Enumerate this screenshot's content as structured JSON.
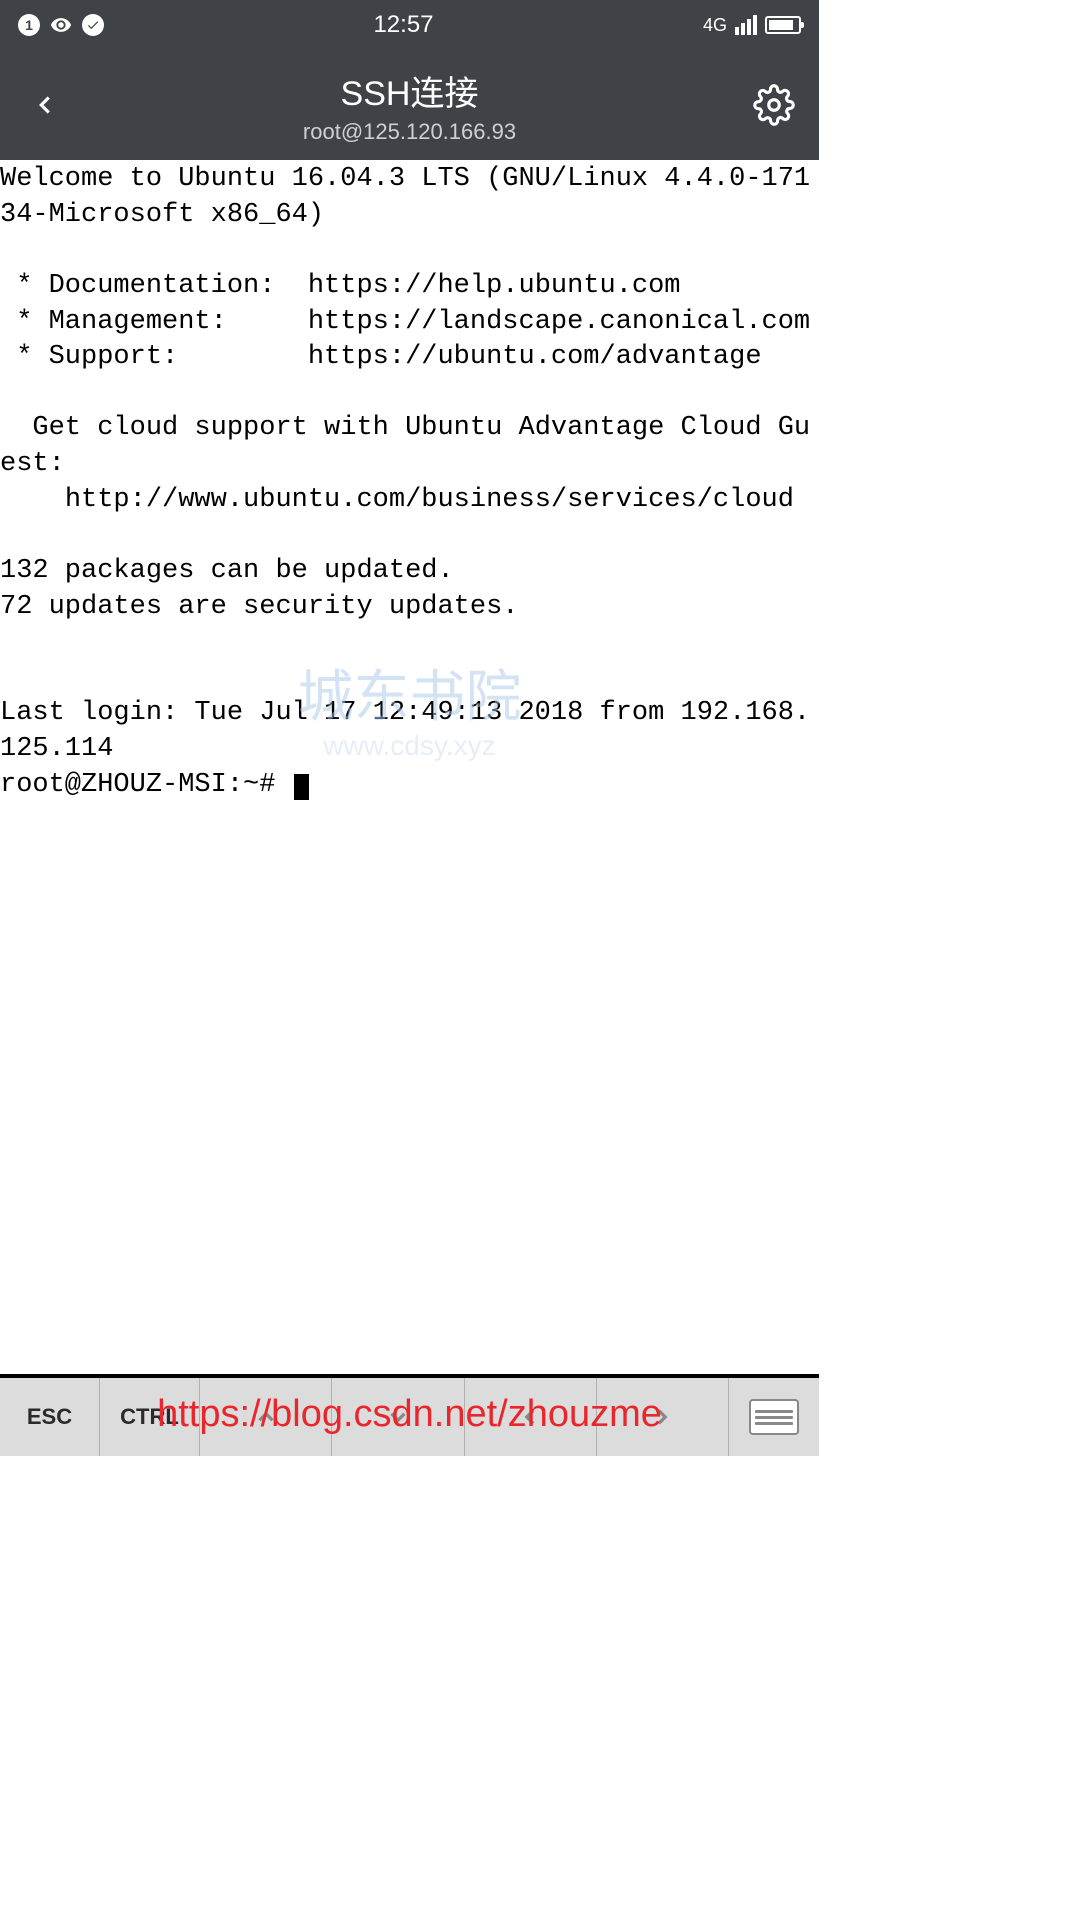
{
  "status_bar": {
    "notif_count": "1",
    "time": "12:57",
    "network": "4G"
  },
  "header": {
    "title": "SSH连接",
    "subtitle": "root@125.120.166.93"
  },
  "terminal": {
    "line1": "Welcome to Ubuntu 16.04.3 LTS (GNU/Linux 4.4.0-17134-Microsoft x86_64)",
    "line2": "",
    "line3": " * Documentation:  https://help.ubuntu.com",
    "line4": " * Management:     https://landscape.canonical.com",
    "line5": " * Support:        https://ubuntu.com/advantage",
    "line6": "",
    "line7": "  Get cloud support with Ubuntu Advantage Cloud Guest:",
    "line8": "    http://www.ubuntu.com/business/services/cloud",
    "line9": "",
    "line10": "132 packages can be updated.",
    "line11": "72 updates are security updates.",
    "line12": "",
    "line13": "",
    "line14": "Last login: Tue Jul 17 12:49:13 2018 from 192.168.125.114",
    "prompt": "root@ZHOUZ-MSI:~# "
  },
  "watermark": {
    "main": "城东书院",
    "sub": "www.cdsy.xyz"
  },
  "bottom_keys": {
    "esc": "ESC",
    "ctrl": "CTRL"
  },
  "url_overlay": "https://blog.csdn.net/zhouzme"
}
